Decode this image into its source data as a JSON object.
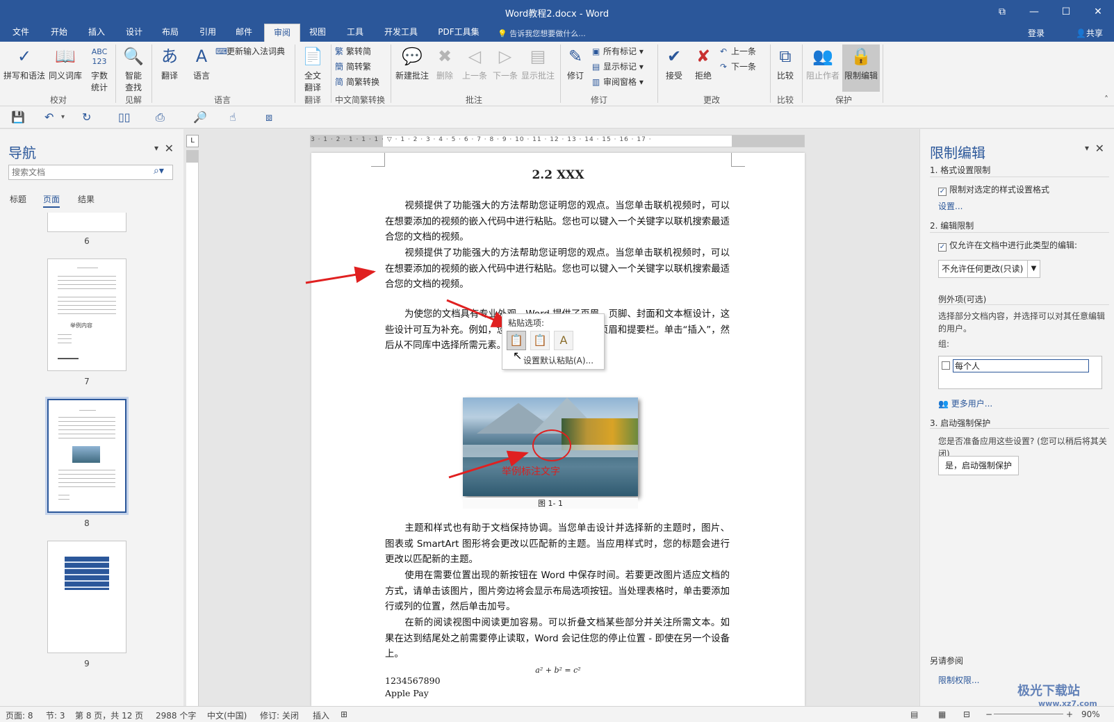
{
  "window": {
    "title": "Word教程2.docx - Word",
    "controls": [
      "⧉",
      "—",
      "☐",
      "✕"
    ]
  },
  "tabs": [
    "文件",
    "开始",
    "插入",
    "设计",
    "布局",
    "引用",
    "邮件",
    "审阅",
    "视图",
    "工具",
    "开发工具",
    "PDF工具集"
  ],
  "active_tab": "审阅",
  "tellme": "告诉我您想要做什么...",
  "login": "登录",
  "share": "共享",
  "ribbon": {
    "proofing": {
      "spell": "拼写和语法",
      "thesaurus": "同义词库",
      "wordcount": "字数\n统计",
      "abc": "ABC\n123",
      "label": "校对"
    },
    "insights": {
      "smart": "智能\n查找",
      "label": "见解"
    },
    "language": {
      "translate": "翻译",
      "language": "语言",
      "update_ime": "更新输入法词典",
      "label": "语言"
    },
    "translate_group": {
      "full": "全文\n翻译",
      "label": "翻译"
    },
    "chinese": {
      "t2s": "繁转简",
      "s2t": "简转繁",
      "convert": "简繁转换",
      "label": "中文简繁转换"
    },
    "comments": {
      "new": "新建批注",
      "delete": "删除",
      "prev": "上一条",
      "next": "下一条",
      "show": "显示批注",
      "label": "批注"
    },
    "tracking": {
      "track": "修订",
      "all_markup": "所有标记",
      "show_markup": "显示标记",
      "review_pane": "审阅窗格",
      "label": "修订"
    },
    "changes": {
      "accept": "接受",
      "reject": "拒绝",
      "prev": "上一条",
      "next": "下一条",
      "label": "更改"
    },
    "compare": {
      "compare": "比较",
      "label": "比较"
    },
    "protect": {
      "block": "阻止作者",
      "restrict": "限制编辑",
      "label": "保护"
    }
  },
  "nav": {
    "title": "导航",
    "search_placeholder": "搜索文档",
    "tabs": [
      "标题",
      "页面",
      "结果"
    ],
    "active_tab": "页面",
    "pages": [
      "6",
      "7",
      "8",
      "9"
    ],
    "page7_heading": "举例内容"
  },
  "document": {
    "heading": "2.2 XXX",
    "para1": "视频提供了功能强大的方法帮助您证明您的观点。当您单击联机视频时，可以在想要添加的视频的嵌入代码中进行粘贴。您也可以键入一个关键字以联机搜索最适合您的文档的视频。",
    "para2": "视频提供了功能强大的方法帮助您证明您的观点。当您单击联机视频时，可以在想要添加的视频的嵌入代码中进行粘贴。您也可以键入一个关键字以联机搜索最适合您的文档的视频。",
    "para3": "为使您的文档具有专业外观，Word 提供了页眉、页脚、封面和文本框设计，这些设计可互为补充。例如，您可以添加匹配的封面、页眉和提要栏。单击“插入”，然后从不同库中选择所需元素。",
    "figure_annotation": "举例标注文字",
    "figure_caption": "图 1- 1",
    "para4": "主题和样式也有助于文档保持协调。当您单击设计并选择新的主题时，图片、图表或 SmartArt 图形将会更改以匹配新的主题。当应用样式时，您的标题会进行更改以匹配新的主题。",
    "para5": "使用在需要位置出现的新按钮在 Word 中保存时间。若要更改图片适应文档的方式，请单击该图片，图片旁边将会显示布局选项按钮。当处理表格时，单击要添加行或列的位置，然后单击加号。",
    "para6": "在新的阅读视图中阅读更加容易。可以折叠文档某些部分并关注所需文本。如果在达到结尾处之前需要停止读取，Word 会记住您的停止位置 - 即使在另一个设备上。",
    "formula": "a² + b² = c²",
    "line_numbers": "1234567890",
    "line_apple": "Apple Pay"
  },
  "paste_menu": {
    "title": "粘贴选项:",
    "options": [
      "keep-source-formatting",
      "merge-formatting",
      "keep-text-only"
    ],
    "default": "设置默认粘贴(A)..."
  },
  "restrict_pane": {
    "title": "限制编辑",
    "s1": "1. 格式设置限制",
    "s1_check": "限制对选定的样式设置格式",
    "s1_check_on": true,
    "s1_link": "设置...",
    "s2": "2. 编辑限制",
    "s2_check": "仅允许在文档中进行此类型的编辑:",
    "s2_check_on": true,
    "s2_select": "不允许任何更改(只读)",
    "exceptions": "例外项(可选)",
    "exceptions_text": "选择部分文档内容，并选择可以对其任意编辑的用户。",
    "groups_label": "组:",
    "group_everyone": "每个人",
    "more_users": "更多用户...",
    "s3": "3. 启动强制保护",
    "s3_text": "您是否准备应用这些设置? (您可以稍后将其关闭)",
    "s3_button": "是，启动强制保护",
    "see_also": "另请参阅",
    "permissions_link": "限制权限..."
  },
  "status": {
    "page": "页面: 8",
    "section": "节: 3",
    "pages": "第 8 页，共 12 页",
    "words": "2988 个字",
    "lang": "中文(中国)",
    "track": "修订: 关闭",
    "insert": "插入",
    "zoom": "90%"
  },
  "watermark": {
    "text": "极光下载站",
    "url": "www.xz7.com"
  },
  "ruler": {
    "h_numbers": "3 · 1 · 2 · 1 · 1 · 1 · ▽ · 1 · 2 · 3 · 4 · 5 · 6 · 7 · 8 · 9 · 10 · 11 · 12 · 13 · 14 · 15 · 16 · 17 ·",
    "v_corner": "L"
  },
  "colors": {
    "accent": "#2b579a",
    "annotation_red": "#e02020"
  }
}
